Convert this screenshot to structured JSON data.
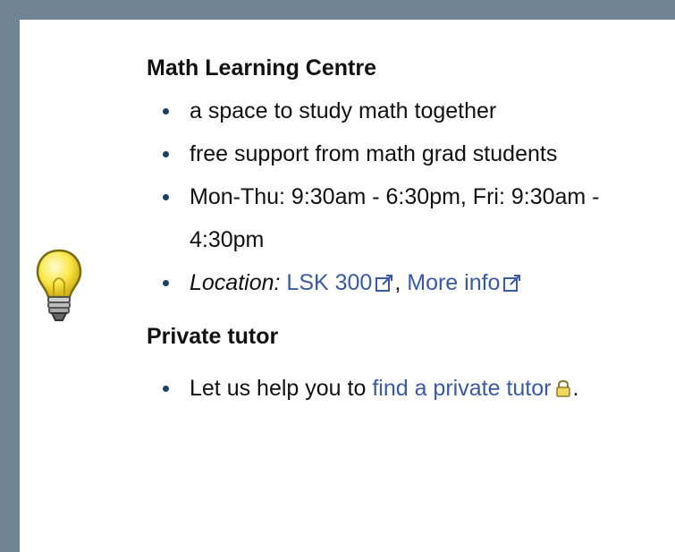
{
  "math_centre": {
    "title": "Math Learning Centre",
    "items": [
      "a space to study math together",
      "free support from math grad students",
      "Mon-Thu: 9:30am - 6:30pm, Fri: 9:30am - 4:30pm"
    ],
    "location_label": "Location:",
    "location_link": "LSK 300",
    "separator": ",",
    "more_info_link": "More info"
  },
  "private_tutor": {
    "title": "Private tutor",
    "text_before": "Let us help you to",
    "link": "find a private tutor",
    "text_after": "."
  },
  "colors": {
    "border": "#6f8596",
    "link": "#3a5aa8",
    "bullet": "#1c3f63"
  },
  "icons": [
    "lightbulb-icon",
    "external-link-icon",
    "lock-icon"
  ]
}
